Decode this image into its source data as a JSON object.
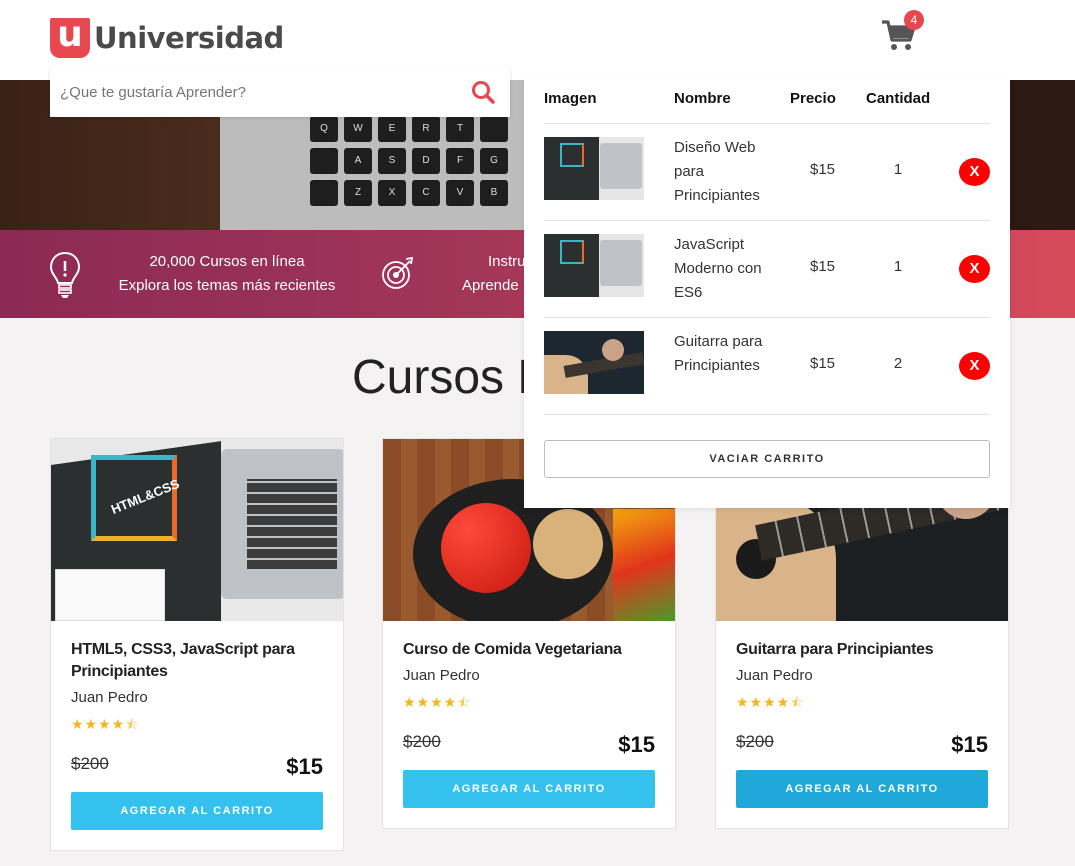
{
  "header": {
    "logo_mark": "u",
    "logo_text": "Universidad",
    "cart_count": "4"
  },
  "search": {
    "placeholder": "¿Que te gustaría Aprender?"
  },
  "hero": {
    "keys": [
      "Q",
      "W",
      "E",
      "R",
      "T",
      "",
      "",
      "A",
      "S",
      "D",
      "F",
      "G",
      "",
      "Z",
      "X",
      "C",
      "V",
      "B"
    ]
  },
  "info_bar": {
    "item1_line1": "20,000 Cursos en línea",
    "item1_line2": "Explora los temas más recientes",
    "item2_line1": "Instru",
    "item2_line2": "Aprende"
  },
  "section_title": "Cursos P",
  "courses": [
    {
      "title": "HTML5, CSS3, JavaScript para Principiantes",
      "author": "Juan Pedro",
      "old_price": "$200",
      "price": "$15",
      "button": "AGREGAR AL CARRITO",
      "image_label": "HTML&CSS"
    },
    {
      "title": "Curso de Comida Vegetariana",
      "author": "Juan Pedro",
      "old_price": "$200",
      "price": "$15",
      "button": "AGREGAR AL CARRITO"
    },
    {
      "title": "Guitarra para Principiantes",
      "author": "Juan Pedro",
      "old_price": "$200",
      "price": "$15",
      "button": "AGREGAR AL CARRITO"
    }
  ],
  "rating": 4.5,
  "cart": {
    "headers": {
      "image": "Imagen",
      "name": "Nombre",
      "price": "Precio",
      "quantity": "Cantidad"
    },
    "items": [
      {
        "name": "Diseño Web para Principiantes",
        "price": "$15",
        "quantity": "1",
        "remove": "X"
      },
      {
        "name": "JavaScript Moderno con ES6",
        "price": "$15",
        "quantity": "1",
        "remove": "X"
      },
      {
        "name": "Guitarra para Principiantes",
        "price": "$15",
        "quantity": "2",
        "remove": "X"
      }
    ],
    "empty_button": "VACIAR CARRITO"
  },
  "colors": {
    "brand_red": "#e7474f",
    "button_blue": "#35c1ee",
    "remove_red": "#ff0000",
    "star_gold": "#f3b61f"
  }
}
